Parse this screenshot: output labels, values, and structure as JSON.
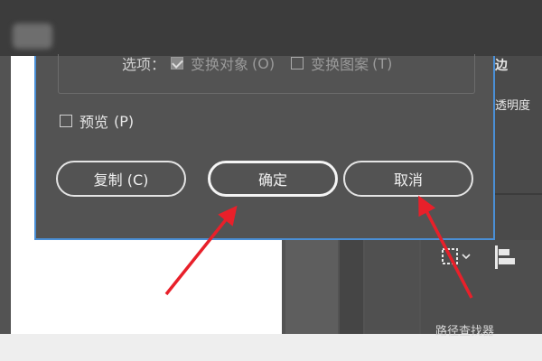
{
  "dialog": {
    "options": {
      "label": "选项：",
      "transform_objects": {
        "label": "变换对象",
        "key": "(O)",
        "checked": true
      },
      "transform_patterns": {
        "label": "变换图案",
        "key": "(T)",
        "checked": false
      }
    },
    "preview": {
      "label": "预览",
      "key": "(P)",
      "checked": false
    },
    "buttons": {
      "copy": "复制 (C)",
      "ok": "确定",
      "cancel": "取消"
    }
  },
  "right_panel": {
    "edge_label": "边",
    "opacity_label": "透明度",
    "bottom_label": "路径查找器"
  },
  "colors": {
    "dialog_bg": "#535353",
    "dialog_border": "#4a8fd6",
    "button_border": "#e4e4e4",
    "annotation_arrow": "#e8202a"
  }
}
